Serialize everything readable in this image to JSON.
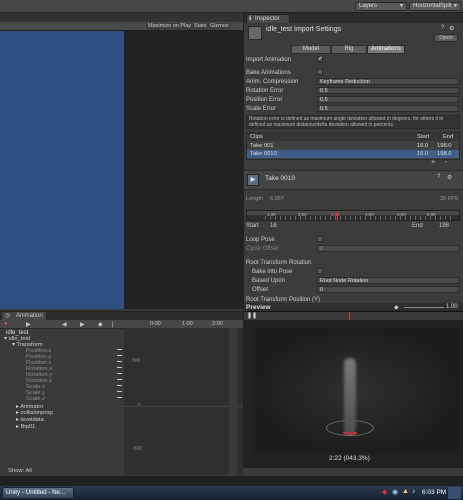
{
  "toolbar": {
    "layers": "Layers",
    "layout": "HorizontalSplit"
  },
  "game_view": {
    "maximize": "Maximize on Play",
    "stats": "Stats",
    "gizmos": "Gizmos"
  },
  "inspector": {
    "tab": "Inspector",
    "title": "idle_test Import Settings",
    "open": "Open",
    "tabs": [
      "Model",
      "Rig",
      "Animations"
    ],
    "import_animation": "Import Animation",
    "bake_animations": "Bake Animations",
    "anim_compression": "Anim. Compression",
    "anim_compression_value": "Keyframe Reduction",
    "rotation_error": "Rotation Error",
    "rotation_error_value": "0.5",
    "position_error": "Position Error",
    "position_error_value": "0.5",
    "scale_error": "Scale Error",
    "scale_error_value": "0.5",
    "note": "Rotation error is defined as maximum angle deviation allowed in degrees, for others it is defined as maximum distance/delta deviation allowed in percents",
    "clips_header": {
      "name": "Clips",
      "start": "Start",
      "end": "End"
    },
    "clips": [
      {
        "name": "Take 001",
        "start": "16.0",
        "end": "198.0"
      },
      {
        "name": "Take 0010",
        "start": "16.0",
        "end": "198.0"
      }
    ],
    "add": "+",
    "remove": "-",
    "clip_name": "Take 0010",
    "length_label": "Length",
    "length_value": "6.067",
    "fps": "30 FPS",
    "timeline_ticks": [
      "1:00",
      "2:00",
      "3:00",
      "4:00",
      "5:00",
      "6:00"
    ],
    "start_label": "Start",
    "start_value": "16",
    "end_label": "End",
    "end_value": "198",
    "loop_pose": "Loop Pose",
    "cycle_offset": "Cycle Offset",
    "cycle_offset_value": "0",
    "root_rotation": "Root Transform Rotation",
    "bake_into_pose": "Bake into Pose",
    "based_upon": "Based Upon",
    "based_upon_value": "Root Node Rotation",
    "offset": "Offset",
    "offset_value": "0",
    "root_position": "Root Transform Position (Y)"
  },
  "preview": {
    "title": "Preview",
    "speed": "1.00",
    "time": "2:22 (043.3%)"
  },
  "animation": {
    "tab": "Animation",
    "clip": "idle_test",
    "ticks": [
      "0:00",
      "1:00",
      "2:00"
    ],
    "graph_labels": [
      "500",
      "0",
      "-500"
    ],
    "tree": [
      {
        "label": "idle_test",
        "sub": false,
        "indent": 0
      },
      {
        "label": "Transform",
        "sub": false,
        "indent": 1
      },
      {
        "label": "Position.x",
        "sub": true,
        "indent": 2
      },
      {
        "label": "Position.y",
        "sub": true,
        "indent": 2
      },
      {
        "label": "Position.z",
        "sub": true,
        "indent": 2
      },
      {
        "label": "Rotation.x",
        "sub": true,
        "indent": 2
      },
      {
        "label": "Rotation.y",
        "sub": true,
        "indent": 2
      },
      {
        "label": "Rotation.z",
        "sub": true,
        "indent": 2
      },
      {
        "label": "Scale.x",
        "sub": true,
        "indent": 2
      },
      {
        "label": "Scale.y",
        "sub": true,
        "indent": 2
      },
      {
        "label": "Scale.z",
        "sub": true,
        "indent": 2
      },
      {
        "label": "Animator",
        "sub": false,
        "indent": 1
      },
      {
        "label": "collisionprop",
        "sub": false,
        "indent": 1
      },
      {
        "label": "leveldata",
        "sub": false,
        "indent": 1
      },
      {
        "label": "Bip01",
        "sub": false,
        "indent": 1
      }
    ],
    "show_all": "Show: All"
  },
  "taskbar": {
    "app": "Unity - Untitled - Ne...",
    "time": "6:03 PM"
  }
}
